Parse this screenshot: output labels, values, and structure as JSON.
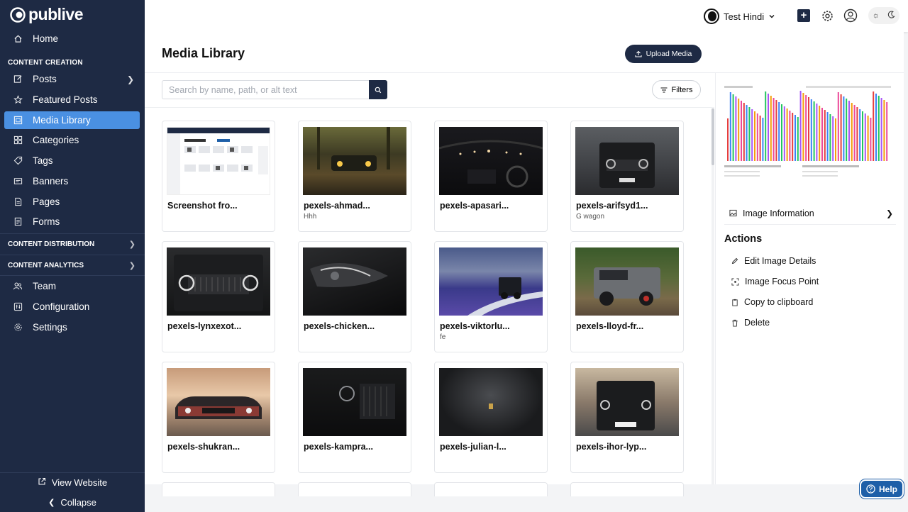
{
  "brand": {
    "name": "publive"
  },
  "sidebar": {
    "home": "Home",
    "content_creation_label": "CONTENT CREATION",
    "items": [
      {
        "label": "Posts",
        "icon": "edit-icon"
      },
      {
        "label": "Featured Posts",
        "icon": "star-icon"
      },
      {
        "label": "Media Library",
        "icon": "media-icon"
      },
      {
        "label": "Categories",
        "icon": "categories-icon"
      },
      {
        "label": "Tags",
        "icon": "tag-icon"
      },
      {
        "label": "Banners",
        "icon": "banner-icon"
      },
      {
        "label": "Pages",
        "icon": "page-icon"
      },
      {
        "label": "Forms",
        "icon": "form-icon"
      }
    ],
    "content_distribution": "CONTENT DISTRIBUTION",
    "content_analytics": "CONTENT ANALYTICS",
    "team": "Team",
    "configuration": "Configuration",
    "settings": "Settings",
    "view_website": "View Website",
    "collapse": "Collapse",
    "active_color": "#4a90e2"
  },
  "topbar": {
    "workspace": "Test Hindi"
  },
  "main": {
    "title": "Media Library",
    "upload_label": "Upload Media",
    "search_placeholder": "Search by name, path, or alt text",
    "filters_label": "Filters",
    "media": [
      {
        "name": "Screenshot fro...",
        "alt": ""
      },
      {
        "name": "pexels-ahmad...",
        "alt": "Hhh"
      },
      {
        "name": "pexels-apasari...",
        "alt": ""
      },
      {
        "name": "pexels-arifsyd1...",
        "alt": "G wagon"
      },
      {
        "name": "pexels-lynxexot...",
        "alt": ""
      },
      {
        "name": "pexels-chicken...",
        "alt": ""
      },
      {
        "name": "pexels-viktorlu...",
        "alt": "fe"
      },
      {
        "name": "pexels-lloyd-fr...",
        "alt": ""
      },
      {
        "name": "pexels-shukran...",
        "alt": ""
      },
      {
        "name": "pexels-kampra...",
        "alt": ""
      },
      {
        "name": "pexels-julian-l...",
        "alt": ""
      },
      {
        "name": "pexels-ihor-lyp...",
        "alt": ""
      }
    ]
  },
  "panel": {
    "image_information": "Image Information",
    "actions_title": "Actions",
    "actions": [
      "Edit Image Details",
      "Image Focus Point",
      "Copy to clipboard",
      "Delete"
    ]
  },
  "help": "Help"
}
